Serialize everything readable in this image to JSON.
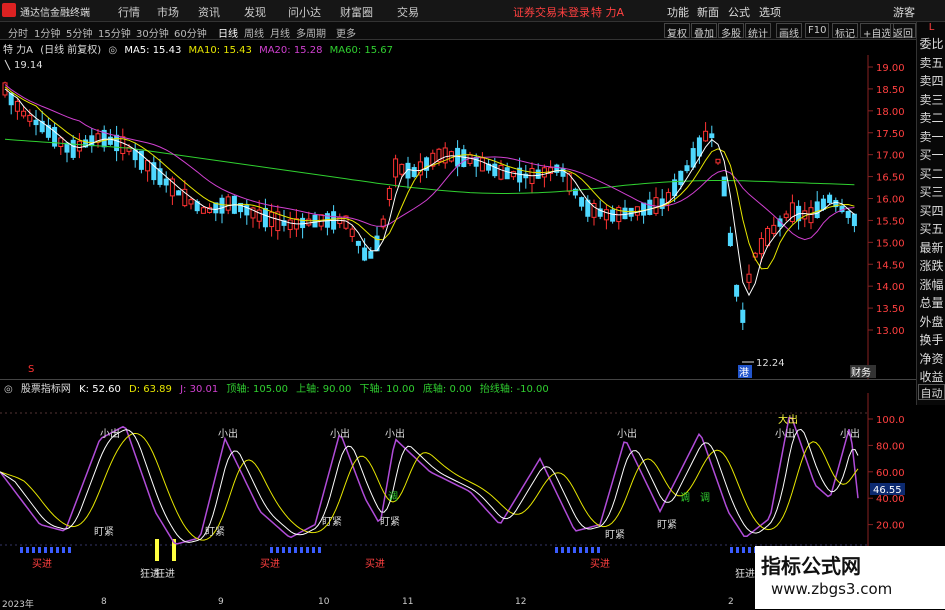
{
  "menubar": {
    "app_title": "通达信金融终端",
    "items": [
      "行情",
      "市场",
      "资讯",
      "发现",
      "问小达",
      "财富圈",
      "交易"
    ],
    "notice": "证券交易未登录",
    "stock": "特 力A",
    "right": [
      "功能",
      "新面",
      "公式",
      "选项"
    ],
    "guest": "游客"
  },
  "toolbar": {
    "periods": [
      "分时",
      "1分钟",
      "5分钟",
      "15分钟",
      "30分钟",
      "60分钟",
      "日线",
      "周线",
      "月线",
      "多周期",
      "更多"
    ],
    "active": "日线",
    "right": [
      "复权",
      "叠加",
      "多股",
      "统计",
      "画线",
      "F10",
      "标记",
      "+自选",
      "返回"
    ]
  },
  "legend": {
    "name": "特 力A",
    "mode": "(日线 前复权)",
    "ma5": "MA5: 15.43",
    "ma10": "MA10: 15.43",
    "ma20": "MA20: 15.28",
    "ma60": "MA60: 15.67"
  },
  "colors": {
    "ma5": "#ffffff",
    "ma10": "#e6e600",
    "ma20": "#d040d0",
    "ma60": "#30d030",
    "up": "#ff3333",
    "down": "#4fd8ff"
  },
  "price_axis": [
    "19.00",
    "18.50",
    "18.00",
    "17.50",
    "17.00",
    "16.50",
    "16.00",
    "15.50",
    "15.00",
    "14.50",
    "14.00",
    "13.50",
    "13.00"
  ],
  "annotations": {
    "high": "19.14",
    "low": "12.24",
    "s_marker": "S",
    "bottom_tag": "港",
    "fin_tag": "财务"
  },
  "sidepanel": {
    "label": "L",
    "items": [
      "委比",
      "卖五",
      "卖四",
      "卖三",
      "卖二",
      "卖一",
      "买一",
      "买二",
      "买三",
      "买四",
      "买五",
      "最新",
      "涨跌",
      "涨幅",
      "总量",
      "外盘",
      "换手",
      "净资",
      "收益"
    ]
  },
  "indicator": {
    "name": "股票指标网",
    "k": "K: 52.60",
    "d": "D: 63.89",
    "j": "J: 30.01",
    "top": "顶轴: 105.00",
    "up": "上轴: 90.00",
    "down": "下轴: 10.00",
    "bottom": "底轴: 0.00",
    "rise": "抬线轴: -10.00",
    "axis": [
      "100.0",
      "80.00",
      "60.00",
      "40.00",
      "20.00"
    ],
    "current": "46.55",
    "auto": "自动"
  },
  "ind_labels": {
    "small_out": "小出",
    "big_out": "大出",
    "watch": "盯紧",
    "buy": "买进",
    "crazy": "狂进",
    "adjust": "调",
    "long": "调"
  },
  "dates": [
    "2023年",
    "8",
    "9",
    "10",
    "11",
    "12",
    "2"
  ],
  "watermark": {
    "title": "指标公式网",
    "url": "www.zbgs3.com"
  }
}
